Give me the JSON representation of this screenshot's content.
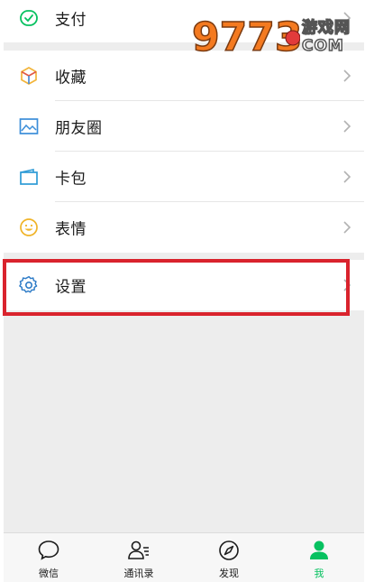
{
  "menu": {
    "pay_label": "支付",
    "favorites_label": "收藏",
    "moments_label": "朋友圈",
    "cards_label": "卡包",
    "stickers_label": "表情",
    "settings_label": "设置"
  },
  "tabbar": {
    "chats_label": "微信",
    "contacts_label": "通讯录",
    "discover_label": "发现",
    "me_label": "我",
    "active_tab": "我"
  },
  "watermark": {
    "number": "9773",
    "site": "游戏网",
    "suffix": "COM"
  },
  "colors": {
    "accent": "#07c160",
    "highlight": "#d9232d",
    "background": "#ededed"
  },
  "icons": [
    "pay-icon",
    "favorites-icon",
    "moments-icon",
    "cards-icon",
    "stickers-icon",
    "settings-icon",
    "chats-icon",
    "contacts-icon",
    "discover-icon",
    "me-icon"
  ]
}
